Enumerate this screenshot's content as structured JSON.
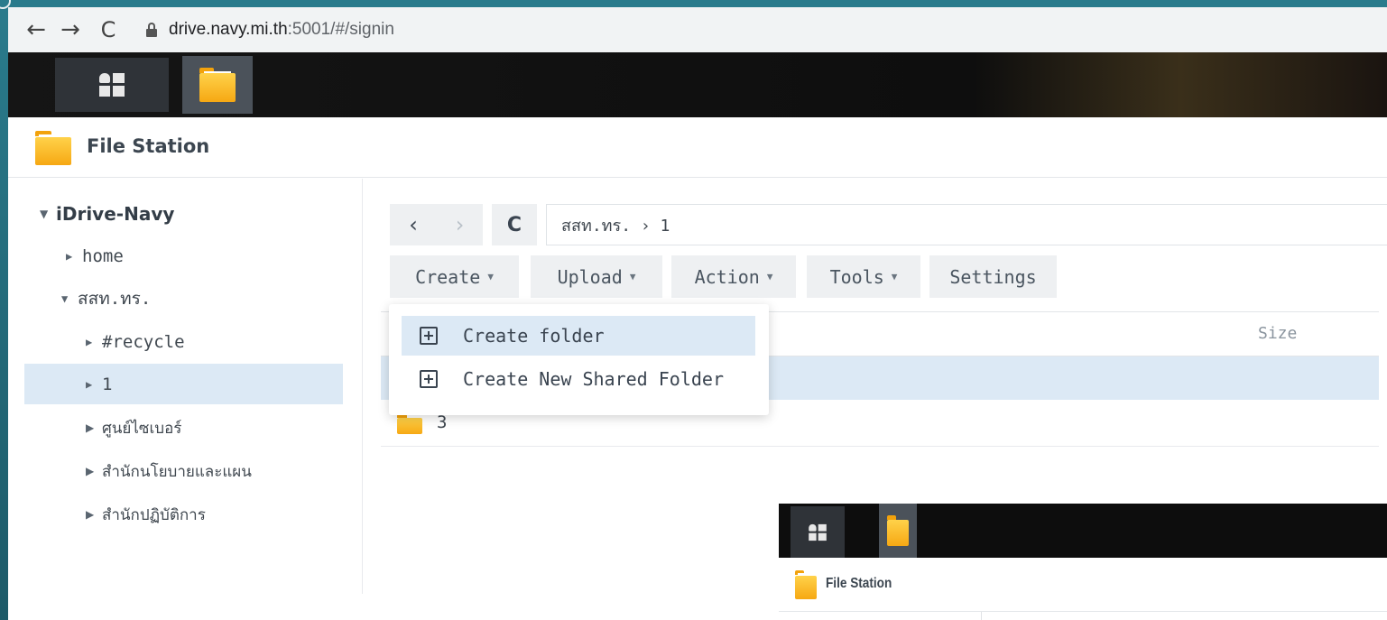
{
  "browser": {
    "back_icon": "←",
    "forward_icon": "→",
    "reload_icon": "C",
    "url_host": "drive.navy.mi.th",
    "url_path": ":5001/#/signin"
  },
  "window": {
    "title": "File Station"
  },
  "sidebar": {
    "root": "iDrive-Navy",
    "items": [
      {
        "label": "home",
        "expanded": false
      },
      {
        "label": "สสท.ทร.",
        "expanded": true
      },
      {
        "label": "#recycle",
        "expanded": false
      },
      {
        "label": "1",
        "expanded": false,
        "selected": true
      },
      {
        "label": "ศูนย์ไซเบอร์",
        "expanded": false
      },
      {
        "label": "สำนักนโยบายและแผน",
        "expanded": false
      },
      {
        "label": "สำนักปฏิบัติการ",
        "expanded": false
      }
    ]
  },
  "toolbar": {
    "path": "สสท.ทร. › 1",
    "create_label": "Create",
    "upload_label": "Upload",
    "action_label": "Action",
    "tools_label": "Tools",
    "settings_label": "Settings"
  },
  "create_menu": {
    "items": [
      "Create folder",
      "Create New Shared Folder"
    ]
  },
  "file_list": {
    "size_header": "Size",
    "rows": [
      {
        "name": "3"
      }
    ]
  },
  "inset": {
    "title": "File Station"
  }
}
